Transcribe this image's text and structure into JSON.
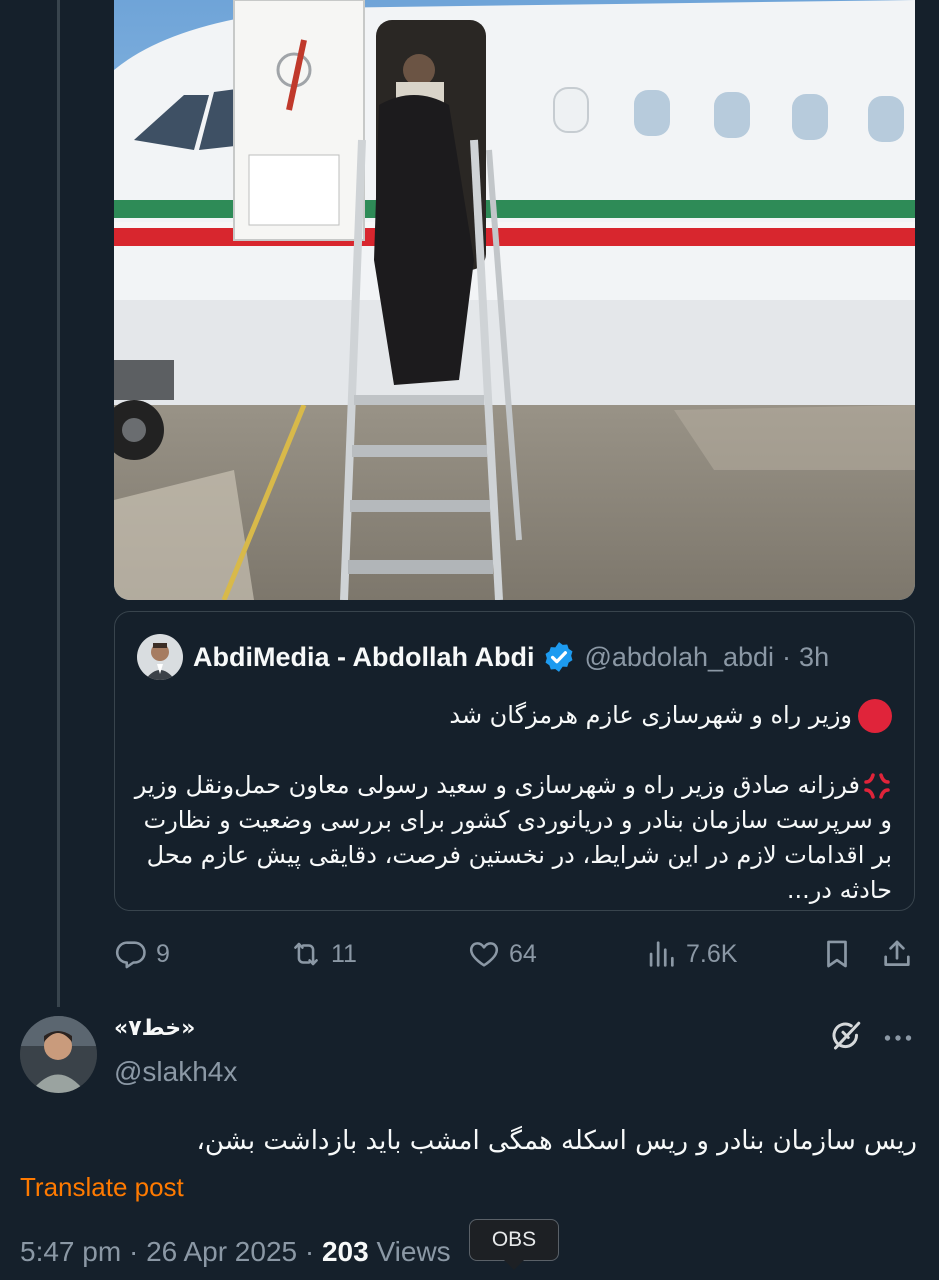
{
  "quoted_post": {
    "display_name": "AbdiMedia - Abdollah Abdi",
    "handle": "@abdolah_abdi",
    "separator": "·",
    "time_ago": "3h",
    "line1": "وزیر راه و شهرسازی عازم هرمزگان شد",
    "paragraph": "فرزانه صادق وزیر راه و شهرسازی و سعید رسولی معاون حمل‌ونقل وزیر و سرپرست سازمان بنادر و دریانوردی کشور برای بررسی وضعیت و نظارت بر اقدامات لازم در این شرایط، در نخستین فرصت، دقایقی پیش عازم محل حادثه در...",
    "icons": [
      "red-circle-emoji",
      "anger-symbol-emoji",
      "verified-badge-icon"
    ]
  },
  "engagement": {
    "replies": "9",
    "reposts": "11",
    "likes": "64",
    "views": "7.6K",
    "icons": [
      "reply-icon",
      "repost-icon",
      "like-icon",
      "views-icon",
      "bookmark-icon",
      "share-icon"
    ]
  },
  "reply_post": {
    "display_name": "«خط۷»",
    "handle": "@slakh4x",
    "text": "ریس سازمان بنادر و ریس اسکله همگی امشب باید بازداشت بشن،",
    "translate_label": "Translate post",
    "time": "5:47 pm",
    "separator": "·",
    "date": "26 Apr 2025",
    "views_count": "203",
    "views_label": "Views",
    "icons": [
      "grok-icon",
      "more-icon"
    ]
  },
  "tooltip": {
    "label": "OBS"
  },
  "colors": {
    "background": "#15202b",
    "border": "#38444d",
    "text": "#f7f9f9",
    "secondary_text": "#8b98a5",
    "verified_blue": "#1d9bf0",
    "translate_orange": "#ff7a00",
    "red_dot": "#e0243a"
  }
}
